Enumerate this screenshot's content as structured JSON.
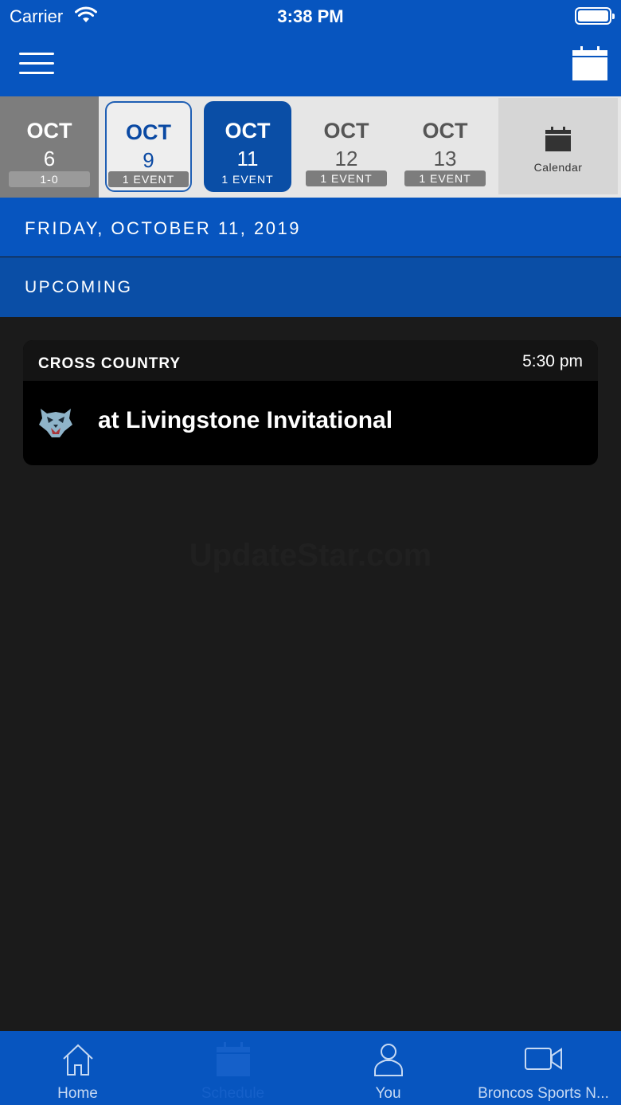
{
  "status_bar": {
    "carrier": "Carrier",
    "time": "3:38 PM"
  },
  "date_strip": {
    "days": [
      {
        "month": "OCT",
        "day": "6",
        "badge": "1-0"
      },
      {
        "month": "OCT",
        "day": "9",
        "badge": "1 EVENT"
      },
      {
        "month": "OCT",
        "day": "11",
        "badge": "1 EVENT"
      },
      {
        "month": "OCT",
        "day": "12",
        "badge": "1 EVENT"
      },
      {
        "month": "OCT",
        "day": "13",
        "badge": "1 EVENT"
      }
    ],
    "calendar_label": "Calendar"
  },
  "date_header": "FRIDAY, OCTOBER 11, 2019",
  "section_header": "UPCOMING",
  "event": {
    "sport": "CROSS COUNTRY",
    "time": "5:30 pm",
    "title": "at Livingstone Invitational"
  },
  "watermark": "UpdateStar.com",
  "tabs": [
    {
      "label": "Home",
      "icon": "home-icon"
    },
    {
      "label": "Schedule",
      "icon": "calendar-icon"
    },
    {
      "label": "You",
      "icon": "person-icon"
    },
    {
      "label": "Broncos Sports N...",
      "icon": "video-icon"
    }
  ],
  "colors": {
    "primary": "#0755bf",
    "selected": "#0a4ea6",
    "background": "#1b1b1b",
    "card": "#000000"
  }
}
